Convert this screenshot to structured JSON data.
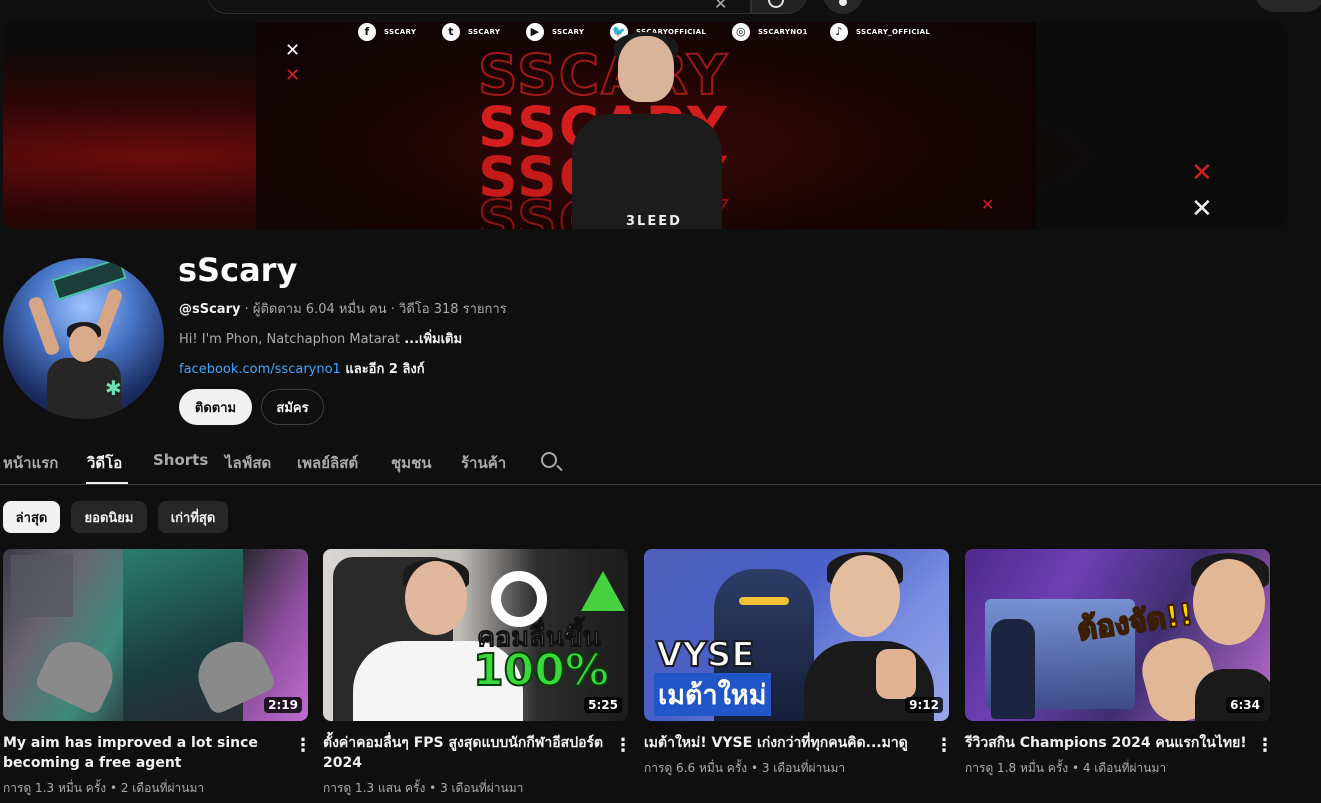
{
  "masthead": {
    "search_clear_glyph": "✕",
    "create_glyph": "+"
  },
  "banner": {
    "socials": [
      {
        "icon": "facebook-icon",
        "glyph": "f",
        "handle": "SSCARY"
      },
      {
        "icon": "twitch-icon",
        "glyph": "t",
        "handle": "SSCARY"
      },
      {
        "icon": "youtube-icon",
        "glyph": "▶",
        "handle": "SSCARY"
      },
      {
        "icon": "twitter-icon",
        "glyph": "🐦",
        "handle": "SSCARYOFFICIAL"
      },
      {
        "icon": "instagram-icon",
        "glyph": "◎",
        "handle": "SSCARYNO1"
      },
      {
        "icon": "tiktok-icon",
        "glyph": "♪",
        "handle": "SSCARY_OFFICIAL"
      }
    ],
    "brand_word": "SSCARY",
    "jersey_logo": "3LEED"
  },
  "channel": {
    "name": "sScary",
    "handle": "@sScary",
    "stats": " · ผู้ติดตาม 6.04 หมื่น คน · วิดีโอ 318 รายการ",
    "description": "Hi! I'm Phon, Natchaphon Matarat ",
    "description_more": "...เพิ่มเติม",
    "link": "facebook.com/sscaryno1",
    "link_more": " และอีก 2 ลิงก์",
    "follow_label": "ติดตาม",
    "join_label": "สมัคร"
  },
  "tabs": [
    "หน้าแรก",
    "วิดีโอ",
    "Shorts",
    "ไลฟ์สด",
    "เพลย์ลิสต์",
    "ชุมชน",
    "ร้านค้า"
  ],
  "active_tab": "วิดีโอ",
  "chips": [
    "ล่าสุด",
    "ยอดนิยม",
    "เก่าที่สุด"
  ],
  "active_chip": "ล่าสุด",
  "videos": [
    {
      "title": "My aim has improved a lot since becoming a free agent",
      "duration": "2:19",
      "meta": "การดู 1.3 หมื่น ครั้ง • 2 เดือนที่ผ่านมา",
      "thumb_text": ""
    },
    {
      "title": "ตั้งค่าคอมลื่นๆ FPS สูงสุดแบบนักกีฬาอีสปอร์ต 2024",
      "duration": "5:25",
      "meta": "การดู 1.3 แสน ครั้ง • 3 เดือนที่ผ่านมา",
      "thumb_text": "คอมลื่นขึ้น",
      "thumb_text2": "100%"
    },
    {
      "title": "เมต้าใหม่! VYSE เก่งกว่าที่ทุกคนคิด...มาดู",
      "duration": "9:12",
      "meta": "การดู 6.6 หมื่น ครั้ง • 3 เดือนที่ผ่านมา",
      "thumb_text": "VYSE",
      "thumb_text2": "เมต้าใหม่"
    },
    {
      "title": "รีวิวสกิน Champions 2024 คนแรกในไทย!",
      "duration": "6:34",
      "meta": "การดู 1.8 หมื่น ครั้ง • 4 เดือนที่ผ่านมา",
      "thumb_text": "ต้องจัด!!"
    }
  ],
  "kebab_glyph": "⋮",
  "colors": {
    "background": "#0f0f0f",
    "link": "#3ea6ff",
    "brand_red": "#d21e1e"
  }
}
